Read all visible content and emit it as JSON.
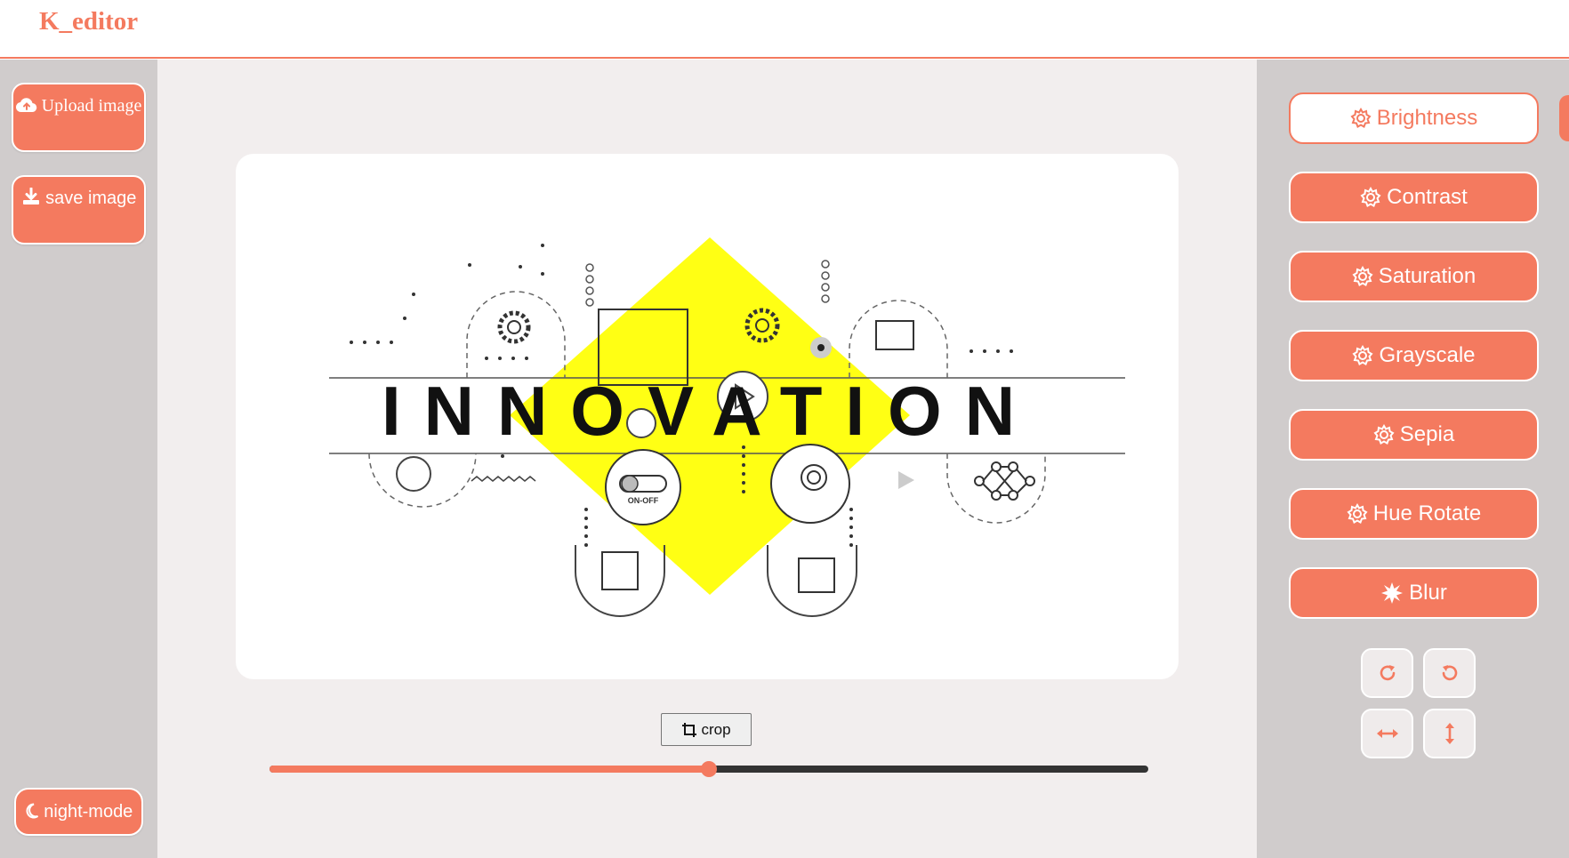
{
  "app": {
    "title": "K_editor"
  },
  "left": {
    "upload": {
      "icon": "cloud-upload-icon",
      "label": "Upload image"
    },
    "save": {
      "icon": "download-icon",
      "label": "save image"
    },
    "night": {
      "icon": "moon-icon",
      "label": "night-mode"
    }
  },
  "canvas": {
    "image": {
      "word": "INNOVATION",
      "switch_label": "ON-OFF"
    }
  },
  "crop": {
    "icon": "crop-icon",
    "label": "crop"
  },
  "slider": {
    "value": 50,
    "min": 0,
    "max": 100
  },
  "filters": [
    {
      "label": "Brightness",
      "icon": "gear-icon",
      "active": true
    },
    {
      "label": "Contrast",
      "icon": "gear-icon",
      "active": false
    },
    {
      "label": "Saturation",
      "icon": "gear-icon",
      "active": false
    },
    {
      "label": "Grayscale",
      "icon": "gear-icon",
      "active": false
    },
    {
      "label": "Sepia",
      "icon": "gear-icon",
      "active": false
    },
    {
      "label": "Hue Rotate",
      "icon": "gear-icon",
      "active": false
    },
    {
      "label": "Blur",
      "icon": "burst-icon",
      "active": false
    }
  ],
  "tools": [
    {
      "name": "rotate-right",
      "icon": "rotate-right-icon"
    },
    {
      "name": "rotate-left",
      "icon": "rotate-left-icon"
    },
    {
      "name": "flip-horizontal",
      "icon": "flip-horizontal-icon"
    },
    {
      "name": "flip-vertical",
      "icon": "flip-vertical-icon"
    }
  ],
  "colors": {
    "accent": "#f47a5f",
    "panel": "#d0cccc",
    "workspace": "#f2eeee",
    "highlight": "#ffff14"
  }
}
